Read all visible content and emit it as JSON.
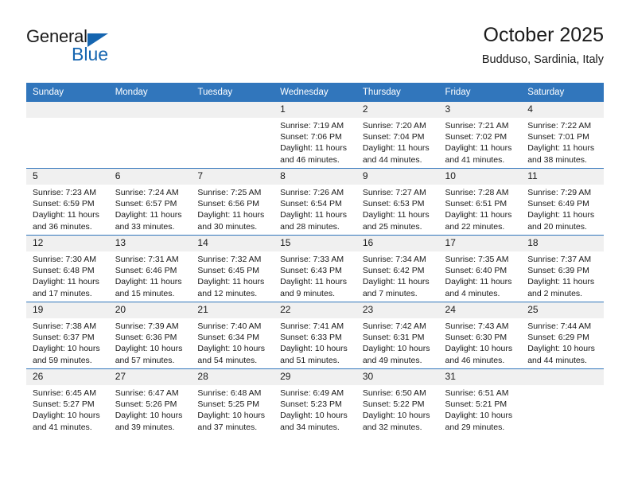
{
  "brand": {
    "name_top": "General",
    "name_bottom": "Blue",
    "triangle_color": "#1565b0"
  },
  "header": {
    "title": "October 2025",
    "subtitle": "Budduso, Sardinia, Italy"
  },
  "theme": {
    "header_blue": "#3176bc",
    "daynum_band": "#f0f0f0",
    "text": "#1a1a1a"
  },
  "weekday_headers": [
    "Sunday",
    "Monday",
    "Tuesday",
    "Wednesday",
    "Thursday",
    "Friday",
    "Saturday"
  ],
  "weeks": [
    [
      {
        "day": "",
        "sunrise": "",
        "sunset": "",
        "daylight1": "",
        "daylight2": "",
        "empty": true
      },
      {
        "day": "",
        "sunrise": "",
        "sunset": "",
        "daylight1": "",
        "daylight2": "",
        "empty": true
      },
      {
        "day": "",
        "sunrise": "",
        "sunset": "",
        "daylight1": "",
        "daylight2": "",
        "empty": true
      },
      {
        "day": "1",
        "sunrise": "Sunrise: 7:19 AM",
        "sunset": "Sunset: 7:06 PM",
        "daylight1": "Daylight: 11 hours",
        "daylight2": "and 46 minutes."
      },
      {
        "day": "2",
        "sunrise": "Sunrise: 7:20 AM",
        "sunset": "Sunset: 7:04 PM",
        "daylight1": "Daylight: 11 hours",
        "daylight2": "and 44 minutes."
      },
      {
        "day": "3",
        "sunrise": "Sunrise: 7:21 AM",
        "sunset": "Sunset: 7:02 PM",
        "daylight1": "Daylight: 11 hours",
        "daylight2": "and 41 minutes."
      },
      {
        "day": "4",
        "sunrise": "Sunrise: 7:22 AM",
        "sunset": "Sunset: 7:01 PM",
        "daylight1": "Daylight: 11 hours",
        "daylight2": "and 38 minutes."
      }
    ],
    [
      {
        "day": "5",
        "sunrise": "Sunrise: 7:23 AM",
        "sunset": "Sunset: 6:59 PM",
        "daylight1": "Daylight: 11 hours",
        "daylight2": "and 36 minutes."
      },
      {
        "day": "6",
        "sunrise": "Sunrise: 7:24 AM",
        "sunset": "Sunset: 6:57 PM",
        "daylight1": "Daylight: 11 hours",
        "daylight2": "and 33 minutes."
      },
      {
        "day": "7",
        "sunrise": "Sunrise: 7:25 AM",
        "sunset": "Sunset: 6:56 PM",
        "daylight1": "Daylight: 11 hours",
        "daylight2": "and 30 minutes."
      },
      {
        "day": "8",
        "sunrise": "Sunrise: 7:26 AM",
        "sunset": "Sunset: 6:54 PM",
        "daylight1": "Daylight: 11 hours",
        "daylight2": "and 28 minutes."
      },
      {
        "day": "9",
        "sunrise": "Sunrise: 7:27 AM",
        "sunset": "Sunset: 6:53 PM",
        "daylight1": "Daylight: 11 hours",
        "daylight2": "and 25 minutes."
      },
      {
        "day": "10",
        "sunrise": "Sunrise: 7:28 AM",
        "sunset": "Sunset: 6:51 PM",
        "daylight1": "Daylight: 11 hours",
        "daylight2": "and 22 minutes."
      },
      {
        "day": "11",
        "sunrise": "Sunrise: 7:29 AM",
        "sunset": "Sunset: 6:49 PM",
        "daylight1": "Daylight: 11 hours",
        "daylight2": "and 20 minutes."
      }
    ],
    [
      {
        "day": "12",
        "sunrise": "Sunrise: 7:30 AM",
        "sunset": "Sunset: 6:48 PM",
        "daylight1": "Daylight: 11 hours",
        "daylight2": "and 17 minutes."
      },
      {
        "day": "13",
        "sunrise": "Sunrise: 7:31 AM",
        "sunset": "Sunset: 6:46 PM",
        "daylight1": "Daylight: 11 hours",
        "daylight2": "and 15 minutes."
      },
      {
        "day": "14",
        "sunrise": "Sunrise: 7:32 AM",
        "sunset": "Sunset: 6:45 PM",
        "daylight1": "Daylight: 11 hours",
        "daylight2": "and 12 minutes."
      },
      {
        "day": "15",
        "sunrise": "Sunrise: 7:33 AM",
        "sunset": "Sunset: 6:43 PM",
        "daylight1": "Daylight: 11 hours",
        "daylight2": "and 9 minutes."
      },
      {
        "day": "16",
        "sunrise": "Sunrise: 7:34 AM",
        "sunset": "Sunset: 6:42 PM",
        "daylight1": "Daylight: 11 hours",
        "daylight2": "and 7 minutes."
      },
      {
        "day": "17",
        "sunrise": "Sunrise: 7:35 AM",
        "sunset": "Sunset: 6:40 PM",
        "daylight1": "Daylight: 11 hours",
        "daylight2": "and 4 minutes."
      },
      {
        "day": "18",
        "sunrise": "Sunrise: 7:37 AM",
        "sunset": "Sunset: 6:39 PM",
        "daylight1": "Daylight: 11 hours",
        "daylight2": "and 2 minutes."
      }
    ],
    [
      {
        "day": "19",
        "sunrise": "Sunrise: 7:38 AM",
        "sunset": "Sunset: 6:37 PM",
        "daylight1": "Daylight: 10 hours",
        "daylight2": "and 59 minutes."
      },
      {
        "day": "20",
        "sunrise": "Sunrise: 7:39 AM",
        "sunset": "Sunset: 6:36 PM",
        "daylight1": "Daylight: 10 hours",
        "daylight2": "and 57 minutes."
      },
      {
        "day": "21",
        "sunrise": "Sunrise: 7:40 AM",
        "sunset": "Sunset: 6:34 PM",
        "daylight1": "Daylight: 10 hours",
        "daylight2": "and 54 minutes."
      },
      {
        "day": "22",
        "sunrise": "Sunrise: 7:41 AM",
        "sunset": "Sunset: 6:33 PM",
        "daylight1": "Daylight: 10 hours",
        "daylight2": "and 51 minutes."
      },
      {
        "day": "23",
        "sunrise": "Sunrise: 7:42 AM",
        "sunset": "Sunset: 6:31 PM",
        "daylight1": "Daylight: 10 hours",
        "daylight2": "and 49 minutes."
      },
      {
        "day": "24",
        "sunrise": "Sunrise: 7:43 AM",
        "sunset": "Sunset: 6:30 PM",
        "daylight1": "Daylight: 10 hours",
        "daylight2": "and 46 minutes."
      },
      {
        "day": "25",
        "sunrise": "Sunrise: 7:44 AM",
        "sunset": "Sunset: 6:29 PM",
        "daylight1": "Daylight: 10 hours",
        "daylight2": "and 44 minutes."
      }
    ],
    [
      {
        "day": "26",
        "sunrise": "Sunrise: 6:45 AM",
        "sunset": "Sunset: 5:27 PM",
        "daylight1": "Daylight: 10 hours",
        "daylight2": "and 41 minutes."
      },
      {
        "day": "27",
        "sunrise": "Sunrise: 6:47 AM",
        "sunset": "Sunset: 5:26 PM",
        "daylight1": "Daylight: 10 hours",
        "daylight2": "and 39 minutes."
      },
      {
        "day": "28",
        "sunrise": "Sunrise: 6:48 AM",
        "sunset": "Sunset: 5:25 PM",
        "daylight1": "Daylight: 10 hours",
        "daylight2": "and 37 minutes."
      },
      {
        "day": "29",
        "sunrise": "Sunrise: 6:49 AM",
        "sunset": "Sunset: 5:23 PM",
        "daylight1": "Daylight: 10 hours",
        "daylight2": "and 34 minutes."
      },
      {
        "day": "30",
        "sunrise": "Sunrise: 6:50 AM",
        "sunset": "Sunset: 5:22 PM",
        "daylight1": "Daylight: 10 hours",
        "daylight2": "and 32 minutes."
      },
      {
        "day": "31",
        "sunrise": "Sunrise: 6:51 AM",
        "sunset": "Sunset: 5:21 PM",
        "daylight1": "Daylight: 10 hours",
        "daylight2": "and 29 minutes."
      },
      {
        "day": "",
        "sunrise": "",
        "sunset": "",
        "daylight1": "",
        "daylight2": "",
        "empty": true
      }
    ]
  ]
}
